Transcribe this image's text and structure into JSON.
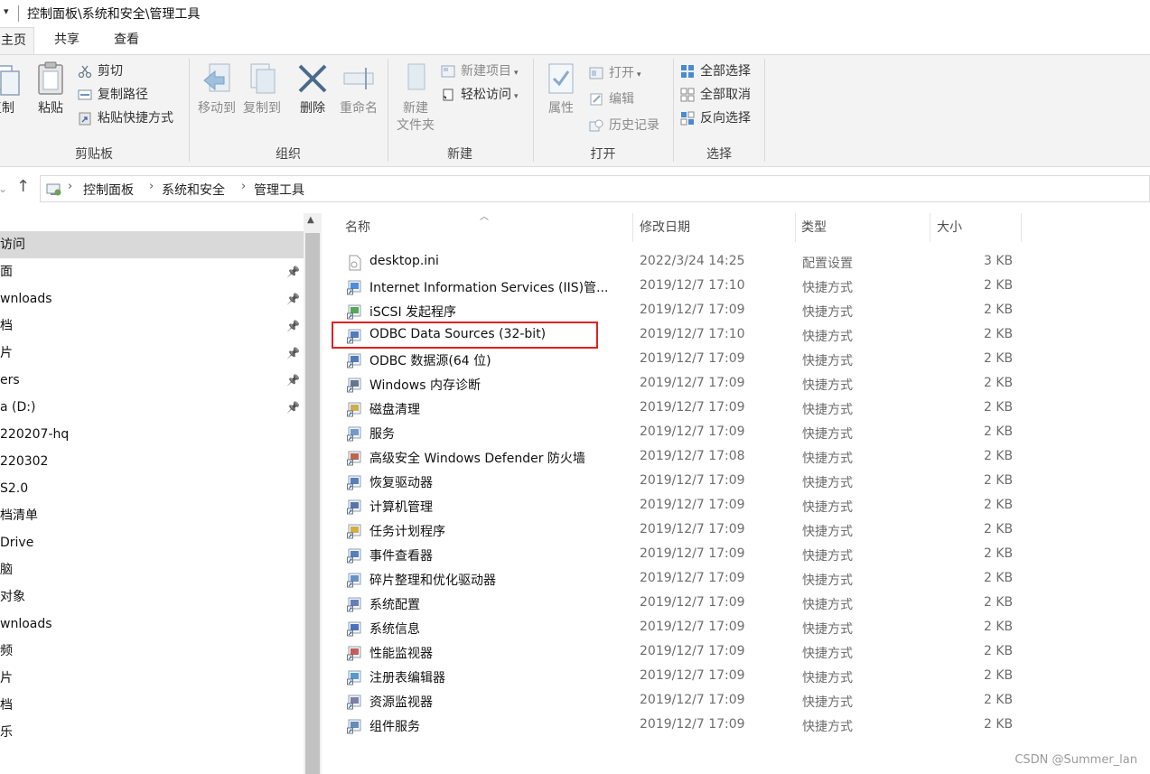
{
  "window": {
    "title": "控制面板\\系统和安全\\管理工具"
  },
  "ribbon": {
    "tabs": [
      "主页",
      "共享",
      "查看"
    ],
    "clipboard": {
      "group_label": "剪贴板",
      "copy": "复制",
      "paste": "粘贴",
      "cut": "剪切",
      "copy_path": "复制路径",
      "paste_shortcut": "粘贴快捷方式"
    },
    "organize": {
      "group_label": "组织",
      "move_to": "移动到",
      "copy_to": "复制到",
      "delete": "删除",
      "rename": "重命名"
    },
    "new": {
      "group_label": "新建",
      "new_folder_line1": "新建",
      "new_folder_line2": "文件夹",
      "new_item": "新建项目",
      "easy_access": "轻松访问"
    },
    "open": {
      "group_label": "打开",
      "properties": "属性",
      "open": "打开",
      "edit": "编辑",
      "history": "历史记录"
    },
    "select": {
      "group_label": "选择",
      "select_all": "全部选择",
      "select_none": "全部取消",
      "invert": "反向选择"
    }
  },
  "address": {
    "breadcrumbs": [
      "控制面板",
      "系统和安全",
      "管理工具"
    ]
  },
  "navpane": {
    "items": [
      {
        "label": "访问",
        "pinned": false,
        "selected": true
      },
      {
        "label": "面",
        "pinned": true
      },
      {
        "label": "wnloads",
        "pinned": true
      },
      {
        "label": "档",
        "pinned": true
      },
      {
        "label": "片",
        "pinned": true
      },
      {
        "label": "ers",
        "pinned": true
      },
      {
        "label": "a (D:)",
        "pinned": true
      },
      {
        "label": "220207-hq",
        "pinned": false
      },
      {
        "label": "220302",
        "pinned": false
      },
      {
        "label": "S2.0",
        "pinned": false
      },
      {
        "label": "档清单",
        "pinned": false
      },
      {
        "label": "Drive",
        "pinned": false
      },
      {
        "label": "脑",
        "pinned": false
      },
      {
        "label": "对象",
        "pinned": false
      },
      {
        "label": "wnloads",
        "pinned": false
      },
      {
        "label": "频",
        "pinned": false
      },
      {
        "label": "片",
        "pinned": false
      },
      {
        "label": "档",
        "pinned": false
      },
      {
        "label": "乐",
        "pinned": false
      }
    ]
  },
  "filelist": {
    "columns": [
      "名称",
      "修改日期",
      "类型",
      "大小"
    ],
    "rows": [
      {
        "name": "desktop.ini",
        "date": "2022/3/24 14:25",
        "type": "配置设置",
        "size": "3 KB",
        "icon": "ini-file-icon"
      },
      {
        "name": "Internet Information Services (IIS)管...",
        "date": "2019/12/7 17:10",
        "type": "快捷方式",
        "size": "2 KB",
        "icon": "iis-icon"
      },
      {
        "name": "iSCSI 发起程序",
        "date": "2019/12/7 17:09",
        "type": "快捷方式",
        "size": "2 KB",
        "icon": "iscsi-icon"
      },
      {
        "name": "ODBC Data Sources (32-bit)",
        "date": "2019/12/7 17:10",
        "type": "快捷方式",
        "size": "2 KB",
        "icon": "odbc-icon"
      },
      {
        "name": "ODBC 数据源(64 位)",
        "date": "2019/12/7 17:09",
        "type": "快捷方式",
        "size": "2 KB",
        "icon": "odbc-icon"
      },
      {
        "name": "Windows 内存诊断",
        "date": "2019/12/7 17:09",
        "type": "快捷方式",
        "size": "2 KB",
        "icon": "memory-diagnostic-icon"
      },
      {
        "name": "磁盘清理",
        "date": "2019/12/7 17:09",
        "type": "快捷方式",
        "size": "2 KB",
        "icon": "disk-cleanup-icon"
      },
      {
        "name": "服务",
        "date": "2019/12/7 17:09",
        "type": "快捷方式",
        "size": "2 KB",
        "icon": "services-icon"
      },
      {
        "name": "高级安全 Windows Defender 防火墙",
        "date": "2019/12/7 17:08",
        "type": "快捷方式",
        "size": "2 KB",
        "icon": "firewall-icon"
      },
      {
        "name": "恢复驱动器",
        "date": "2019/12/7 17:09",
        "type": "快捷方式",
        "size": "2 KB",
        "icon": "recovery-drive-icon"
      },
      {
        "name": "计算机管理",
        "date": "2019/12/7 17:09",
        "type": "快捷方式",
        "size": "2 KB",
        "icon": "computer-management-icon"
      },
      {
        "name": "任务计划程序",
        "date": "2019/12/7 17:09",
        "type": "快捷方式",
        "size": "2 KB",
        "icon": "task-scheduler-icon"
      },
      {
        "name": "事件查看器",
        "date": "2019/12/7 17:09",
        "type": "快捷方式",
        "size": "2 KB",
        "icon": "event-viewer-icon"
      },
      {
        "name": "碎片整理和优化驱动器",
        "date": "2019/12/7 17:09",
        "type": "快捷方式",
        "size": "2 KB",
        "icon": "defrag-icon"
      },
      {
        "name": "系统配置",
        "date": "2019/12/7 17:09",
        "type": "快捷方式",
        "size": "2 KB",
        "icon": "system-config-icon"
      },
      {
        "name": "系统信息",
        "date": "2019/12/7 17:09",
        "type": "快捷方式",
        "size": "2 KB",
        "icon": "system-info-icon"
      },
      {
        "name": "性能监视器",
        "date": "2019/12/7 17:09",
        "type": "快捷方式",
        "size": "2 KB",
        "icon": "performance-monitor-icon"
      },
      {
        "name": "注册表编辑器",
        "date": "2019/12/7 17:09",
        "type": "快捷方式",
        "size": "2 KB",
        "icon": "registry-editor-icon"
      },
      {
        "name": "资源监视器",
        "date": "2019/12/7 17:09",
        "type": "快捷方式",
        "size": "2 KB",
        "icon": "resource-monitor-icon"
      },
      {
        "name": "组件服务",
        "date": "2019/12/7 17:09",
        "type": "快捷方式",
        "size": "2 KB",
        "icon": "component-services-icon"
      }
    ]
  },
  "watermark": "CSDN @Summer_lan",
  "colors": {
    "highlight_box": "#e02020",
    "ribbon_bg": "#f3f3f3",
    "selected_nav": "#d9d9d9"
  }
}
